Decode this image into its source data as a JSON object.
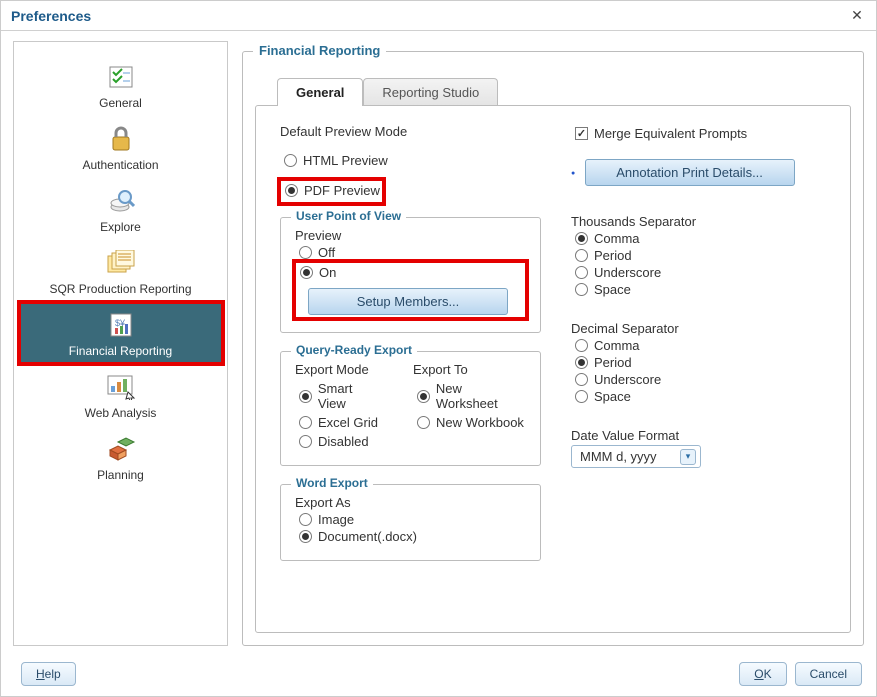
{
  "dialog": {
    "title": "Preferences"
  },
  "sidebar": {
    "items": [
      {
        "label": "General"
      },
      {
        "label": "Authentication"
      },
      {
        "label": "Explore"
      },
      {
        "label": "SQR Production Reporting"
      },
      {
        "label": "Financial Reporting"
      },
      {
        "label": "Web Analysis"
      },
      {
        "label": "Planning"
      }
    ]
  },
  "panel": {
    "title": "Financial Reporting",
    "tabs": {
      "general": "General",
      "studio": "Reporting Studio"
    },
    "defaultPreview": {
      "label": "Default Preview Mode",
      "html": "HTML Preview",
      "pdf": "PDF Preview"
    },
    "upov": {
      "legend": "User Point of View",
      "previewLabel": "Preview",
      "off": "Off",
      "on": "On",
      "setupBtn": "Setup Members..."
    },
    "queryExport": {
      "legend": "Query-Ready Export",
      "modeLabel": "Export Mode",
      "toLabel": "Export To",
      "smart": "Smart View",
      "grid": "Excel Grid",
      "disabled": "Disabled",
      "newWs": "New Worksheet",
      "newWb": "New Workbook"
    },
    "wordExport": {
      "legend": "Word Export",
      "asLabel": "Export As",
      "image": "Image",
      "docx": "Document(.docx)"
    },
    "merge": "Merge Equivalent Prompts",
    "annotBtn": "Annotation Print Details...",
    "thousands": {
      "label": "Thousands Separator",
      "comma": "Comma",
      "period": "Period",
      "underscore": "Underscore",
      "space": "Space"
    },
    "decimal": {
      "label": "Decimal Separator",
      "comma": "Comma",
      "period": "Period",
      "underscore": "Underscore",
      "space": "Space"
    },
    "dateFmt": {
      "label": "Date Value Format",
      "value": "MMM d, yyyy"
    }
  },
  "footer": {
    "help": "Help",
    "ok": "OK",
    "cancel": "Cancel"
  }
}
